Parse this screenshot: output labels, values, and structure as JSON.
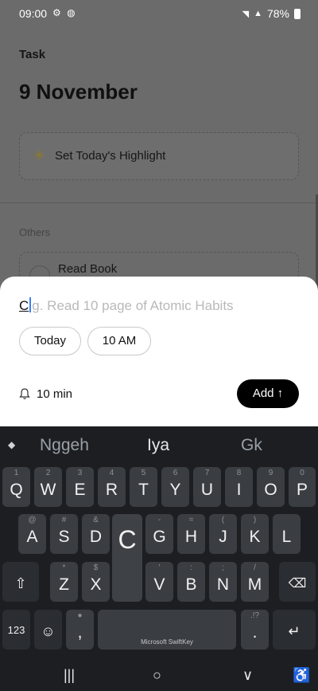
{
  "status": {
    "time": "09:00",
    "battery": "78%"
  },
  "app": {
    "title": "Task",
    "date_heading": "9 November",
    "highlight_label": "Set Today's Highlight",
    "section_label": "Others",
    "task_label": "Read Book"
  },
  "sheet": {
    "typed_text": "C",
    "placeholder": "g. Read 10 page of Atomic Habits",
    "chip_day": "Today",
    "chip_time": "10 AM",
    "reminder": "10 min",
    "add_label": "Add ↑"
  },
  "keyboard": {
    "suggestions": [
      "Nggeh",
      "Iya",
      "Gk"
    ],
    "row1": [
      {
        "hint": "1",
        "key": "Q"
      },
      {
        "hint": "2",
        "key": "W"
      },
      {
        "hint": "3",
        "key": "E"
      },
      {
        "hint": "4",
        "key": "R"
      },
      {
        "hint": "5",
        "key": "T"
      },
      {
        "hint": "6",
        "key": "Y"
      },
      {
        "hint": "7",
        "key": "U"
      },
      {
        "hint": "8",
        "key": "I"
      },
      {
        "hint": "9",
        "key": "O"
      },
      {
        "hint": "0",
        "key": "P"
      }
    ],
    "row2": [
      {
        "hint": "@",
        "key": "A"
      },
      {
        "hint": "#",
        "key": "S"
      },
      {
        "hint": "&",
        "key": "D"
      },
      {
        "hint": "",
        "key": "C"
      },
      {
        "hint": "-",
        "key": "G"
      },
      {
        "hint": "=",
        "key": "H"
      },
      {
        "hint": "(",
        "key": "J"
      },
      {
        "hint": ")",
        "key": "K"
      },
      {
        "hint": "",
        "key": "L"
      }
    ],
    "row3": [
      {
        "hint": "*",
        "key": "Z"
      },
      {
        "hint": "$",
        "key": "X"
      },
      {
        "hint": "'",
        "key": "V"
      },
      {
        "hint": ":",
        "key": "B"
      },
      {
        "hint": ";",
        "key": "N"
      },
      {
        "hint": "/",
        "key": "M"
      }
    ],
    "numbers_label": "123",
    "comma": ",",
    "space_label": "Microsoft SwiftKey",
    "period_hint": ".!?",
    "period": "."
  }
}
